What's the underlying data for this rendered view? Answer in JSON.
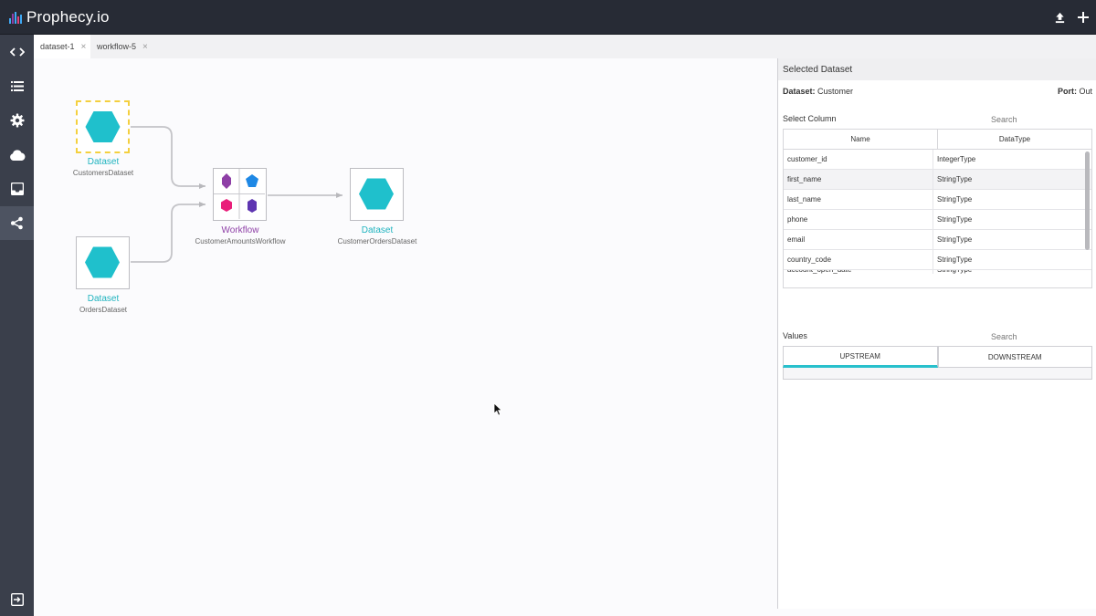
{
  "app": {
    "title": "Prophecy.io"
  },
  "tabs": [
    {
      "label": "dataset-1",
      "close": "×"
    },
    {
      "label": "workflow-5",
      "close": "×"
    }
  ],
  "canvas": {
    "nodes": [
      {
        "kind": "Dataset",
        "name": "CustomersDataset",
        "selected": true
      },
      {
        "kind": "Dataset",
        "name": "OrdersDataset",
        "selected": false
      },
      {
        "kind": "Workflow",
        "name": "CustomerAmountsWorkflow",
        "selected": false
      },
      {
        "kind": "Dataset",
        "name": "CustomerOrdersDataset",
        "selected": false
      }
    ]
  },
  "panel": {
    "title": "Selected Dataset",
    "dataset_label": "Dataset:",
    "dataset_value": "Customer",
    "port_label": "Port:",
    "port_value": "Out",
    "select_column": "Select Column",
    "search_placeholder": "Search",
    "columns": {
      "name": "Name",
      "type": "DataType"
    },
    "rows": [
      {
        "name": "customer_id",
        "type": "IntegerType"
      },
      {
        "name": "first_name",
        "type": "StringType"
      },
      {
        "name": "last_name",
        "type": "StringType"
      },
      {
        "name": "phone",
        "type": "StringType"
      },
      {
        "name": "email",
        "type": "StringType"
      },
      {
        "name": "country_code",
        "type": "StringType"
      },
      {
        "name": "account_open_date",
        "type": "StringType"
      }
    ],
    "values_label": "Values",
    "values_search_placeholder": "Search",
    "value_tabs": [
      "UPSTREAM",
      "DOWNSTREAM"
    ]
  },
  "colors": {
    "header": "#272b35",
    "sidebar": "#3a3f4b",
    "dataset": "#1fc0cc",
    "workflow": "#8e3fa6",
    "selected_border": "#f4d03f",
    "accent": "#28c0cc"
  }
}
